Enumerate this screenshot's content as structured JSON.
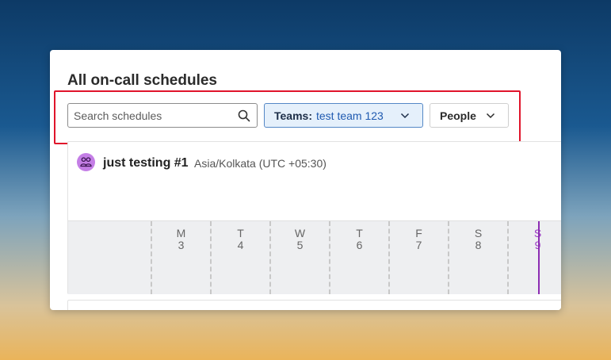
{
  "page": {
    "title": "All on-call schedules"
  },
  "filters": {
    "search_placeholder": "Search schedules",
    "teams_label": "Teams:",
    "teams_value": "test team 123",
    "people_label": "People"
  },
  "schedule": {
    "name": "just testing #1",
    "timezone": "Asia/Kolkata (UTC +05:30)",
    "days": [
      {
        "letter": "M",
        "date": "3"
      },
      {
        "letter": "T",
        "date": "4"
      },
      {
        "letter": "W",
        "date": "5"
      },
      {
        "letter": "T",
        "date": "6"
      },
      {
        "letter": "F",
        "date": "7"
      },
      {
        "letter": "S",
        "date": "8"
      },
      {
        "letter": "S",
        "date": "9"
      }
    ]
  },
  "colors": {
    "highlight": "#e0142b",
    "accent": "#1f5ab0",
    "now_line": "#8c2db3",
    "avatar": "#c47ee6"
  },
  "icons": {
    "search": "search-icon",
    "chevron": "chevron-down-icon",
    "team": "team-icon"
  }
}
